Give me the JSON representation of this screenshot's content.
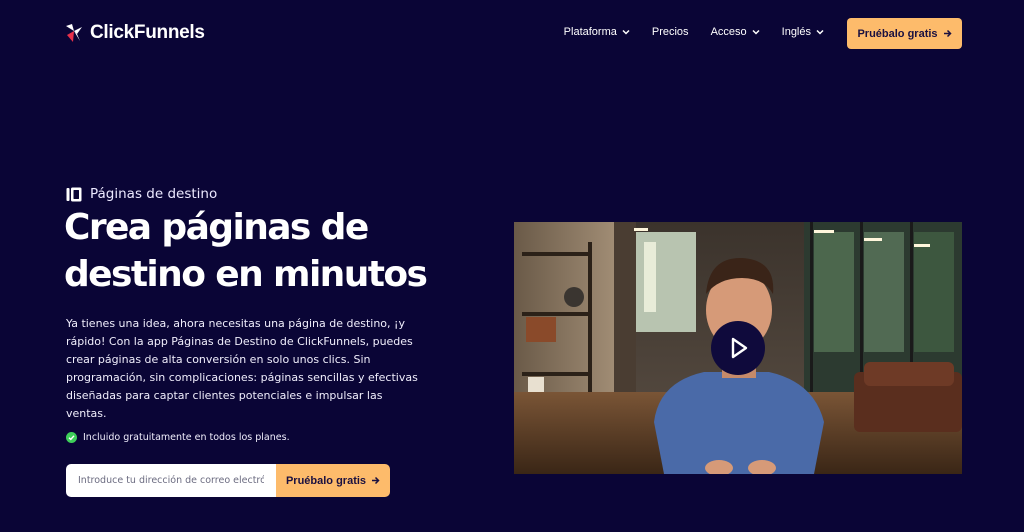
{
  "nav": {
    "brand": "ClickFunnels",
    "links": [
      {
        "label": "Plataforma",
        "has_dropdown": true
      },
      {
        "label": "Precios",
        "has_dropdown": false
      },
      {
        "label": "Acceso",
        "has_dropdown": true
      },
      {
        "label": "Inglés",
        "has_dropdown": true
      }
    ],
    "cta_label": "Pruébalo gratis"
  },
  "hero": {
    "eyebrow": "Páginas de destino",
    "headline_line1": "Crea páginas de",
    "headline_line2": "destino en minutos",
    "body": "Ya tienes una idea, ahora necesitas una página de destino, ¡y rápido! Con la app Páginas de Destino de ClickFunnels, puedes crear páginas de alta conversión en solo unos clics. Sin programación, sin complicaciones: páginas sencillas y efectivas diseñadas para captar clientes potenciales e impulsar las ventas.",
    "included_note": "Incluido gratuitamente en todos los planes.",
    "email_placeholder": "Introduce tu dirección de correo electrónico",
    "form_cta_label": "Pruébalo gratis"
  },
  "video": {
    "play_icon": "play-icon"
  },
  "colors": {
    "background": "#0a0536",
    "accent": "#fdbb6b",
    "check": "#3ecf5a"
  }
}
